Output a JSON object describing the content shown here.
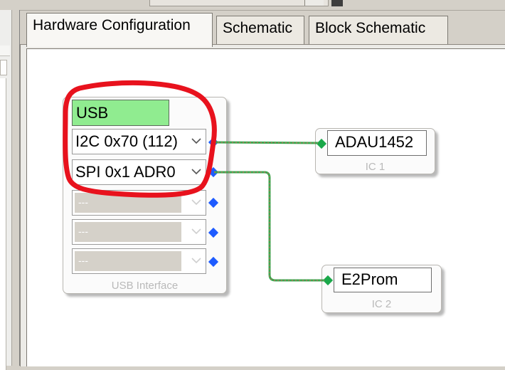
{
  "tabs": [
    {
      "label": "Hardware Configuration",
      "active": true
    },
    {
      "label": "Schematic",
      "active": false
    },
    {
      "label": "Block Schematic",
      "active": false
    }
  ],
  "usb_block": {
    "badge": "USB",
    "title": "USB Interface",
    "ports": [
      {
        "value": "I2C 0x70 (112)",
        "enabled": true
      },
      {
        "value": "SPI 0x1 ADR0",
        "enabled": true
      },
      {
        "value": "---",
        "enabled": false
      },
      {
        "value": "---",
        "enabled": false
      },
      {
        "value": "---",
        "enabled": false
      }
    ]
  },
  "ic1": {
    "name": "ADAU1452",
    "label": "IC 1"
  },
  "ic2": {
    "name": "E2Prom",
    "label": "IC 2"
  },
  "colors": {
    "usb_badge": "#90ec90",
    "port_blue": "#1e5bff",
    "port_green": "#1aa84a",
    "wire": "#3aa84f",
    "wire_dash": "#e05a5a",
    "annotation": "#e8121d"
  },
  "icons": {
    "dropdown": "chevron-down-icon",
    "output_port": "diamond-port-icon",
    "input_port": "diamond-port-icon"
  }
}
